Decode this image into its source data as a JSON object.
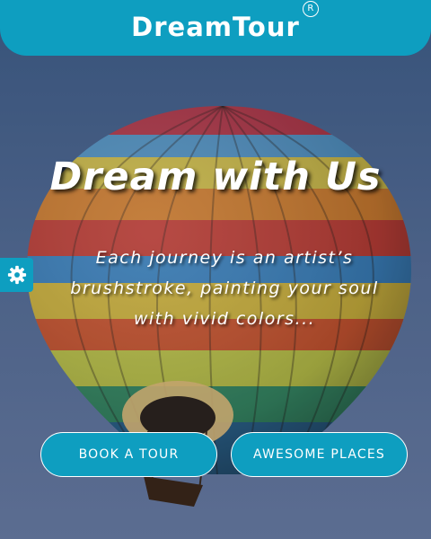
{
  "header": {
    "brand": "DreamTour",
    "registered_mark": "R"
  },
  "hero": {
    "title": "Dream with Us",
    "subtitle": "Each journey is an artist’s brushstroke, painting your soul with vivid colors..."
  },
  "settings": {
    "icon": "gear-icon"
  },
  "buttons": {
    "book": "BOOK A TOUR",
    "places": "AWESOME PLACES"
  },
  "colors": {
    "accent": "#0e9ec0",
    "text": "#ffffff",
    "sky": "#4f6a94"
  }
}
